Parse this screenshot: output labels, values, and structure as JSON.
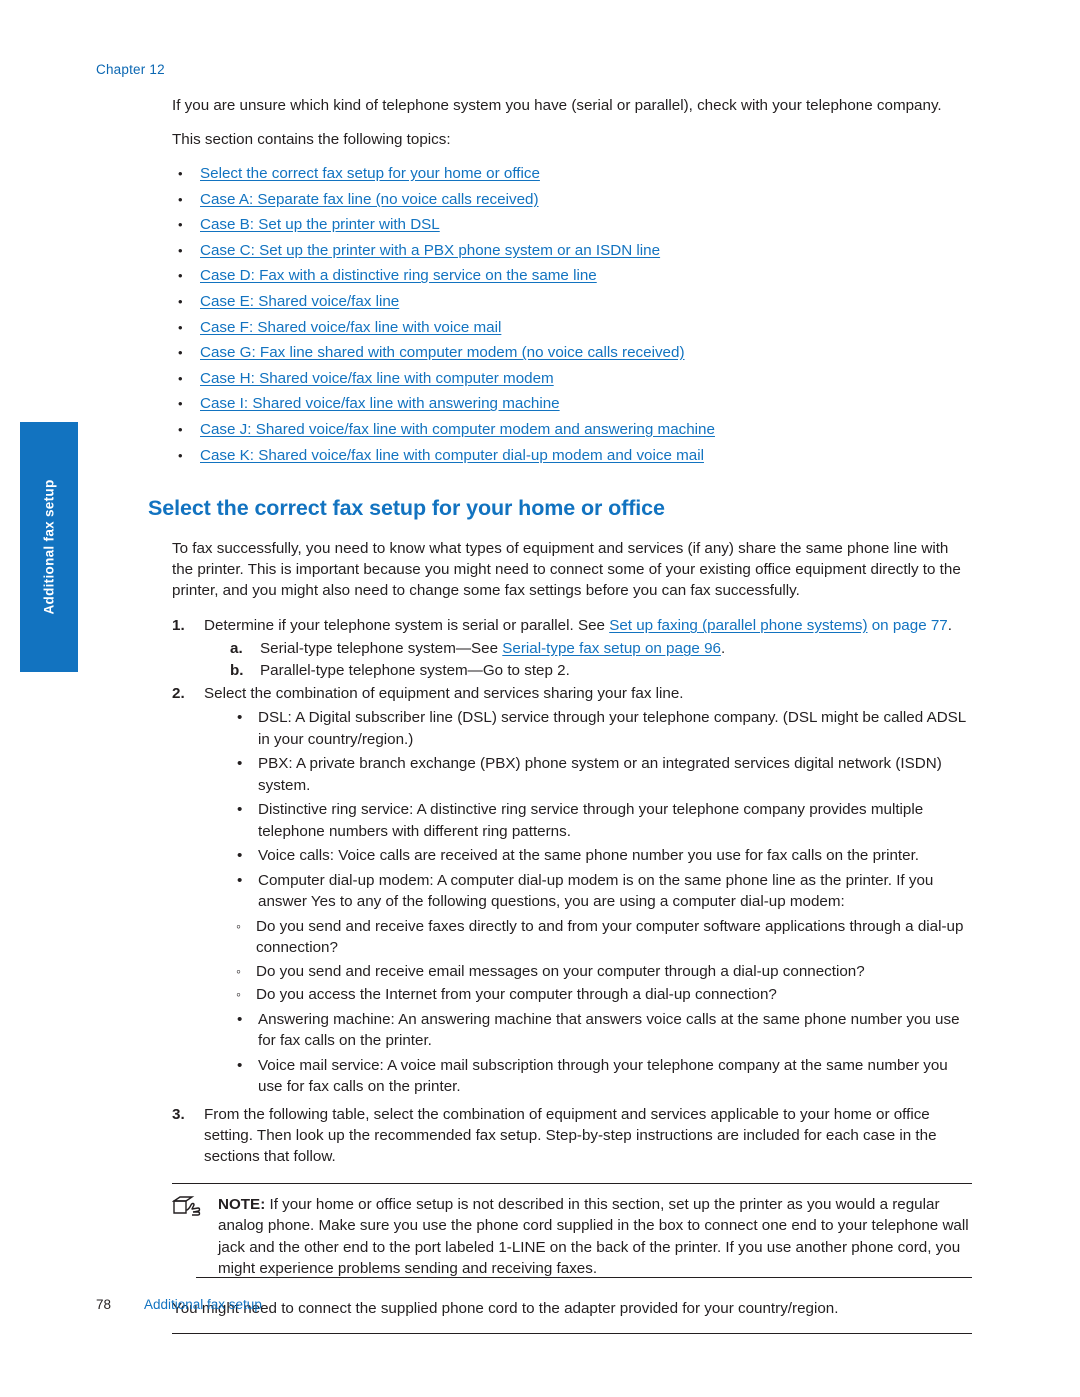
{
  "header": {
    "chapter": "Chapter 12"
  },
  "side_tab": {
    "label": "Additional fax setup"
  },
  "intro": {
    "para1": "If you are unsure which kind of telephone system you have (serial or parallel), check with your telephone company.",
    "para2": "This section contains the following topics:"
  },
  "toc": [
    "Select the correct fax setup for your home or office",
    "Case A: Separate fax line (no voice calls received)",
    "Case B: Set up the printer with DSL",
    "Case C: Set up the printer with a PBX phone system or an ISDN line",
    "Case D: Fax with a distinctive ring service on the same line",
    "Case E: Shared voice/fax line",
    "Case F: Shared voice/fax line with voice mail",
    "Case G: Fax line shared with computer modem (no voice calls received)",
    "Case H: Shared voice/fax line with computer modem",
    "Case I: Shared voice/fax line with answering machine",
    "Case J: Shared voice/fax line with computer modem and answering machine",
    "Case K: Shared voice/fax line with computer dial-up modem and voice mail"
  ],
  "section": {
    "title": "Select the correct fax setup for your home or office",
    "intro": "To fax successfully, you need to know what types of equipment and services (if any) share the same phone line with the printer. This is important because you might need to connect some of your existing office equipment directly to the printer, and you might also need to change some fax settings before you can fax successfully."
  },
  "steps": {
    "step1": {
      "num": "1.",
      "text_before": "Determine if your telephone system is serial or parallel. See ",
      "link": "Set up faxing (parallel phone systems)",
      "text_after": " on page 77",
      "tail": ".",
      "sub_a": {
        "letter": "a.",
        "text_before": "Serial-type telephone system—See ",
        "link": "Serial-type fax setup on page 96",
        "text_after": "."
      },
      "sub_b": {
        "letter": "b.",
        "text": "Parallel-type telephone system—Go to step 2."
      }
    },
    "step2": {
      "num": "2.",
      "text": "Select the combination of equipment and services sharing your fax line.",
      "bullets": [
        "DSL: A Digital subscriber line (DSL) service through your telephone company. (DSL might be called ADSL in your country/region.)",
        "PBX: A private branch exchange (PBX) phone system or an integrated services digital network (ISDN) system.",
        "Distinctive ring service: A distinctive ring service through your telephone company provides multiple telephone numbers with different ring patterns.",
        "Voice calls: Voice calls are received at the same phone number you use for fax calls on the printer.",
        "Computer dial-up modem: A computer dial-up modem is on the same phone line as the printer. If you answer Yes to any of the following questions, you are using a computer dial-up modem:"
      ],
      "subbullets": [
        "Do you send and receive faxes directly to and from your computer software applications through a dial-up connection?",
        "Do you send and receive email messages on your computer through a dial-up connection?",
        "Do you access the Internet from your computer through a dial-up connection?"
      ],
      "bullets_after": [
        "Answering machine: An answering machine that answers voice calls at the same phone number you use for fax calls on the printer.",
        "Voice mail service: A voice mail subscription through your telephone company at the same number you use for fax calls on the printer."
      ]
    },
    "step3": {
      "num": "3.",
      "text": "From the following table, select the combination of equipment and services applicable to your home or office setting. Then look up the recommended fax setup. Step-by-step instructions are included for each case in the sections that follow."
    }
  },
  "note": {
    "icon_name": "note-hand-icon",
    "label": "NOTE:",
    "text": "If your home or office setup is not described in this section, set up the printer as you would a regular analog phone. Make sure you use the phone cord supplied in the box to connect one end to your telephone wall jack and the other end to the port labeled 1-LINE on the back of the printer. If you use another phone cord, you might experience problems sending and receiving faxes.",
    "after": "You might need to connect the supplied phone cord to the adapter provided for your country/region."
  },
  "footer": {
    "page_number": "78",
    "text": "Additional fax setup"
  },
  "colors": {
    "link_blue": "#1273c0",
    "header_blue": "#0b67b2",
    "text": "#231f20"
  }
}
